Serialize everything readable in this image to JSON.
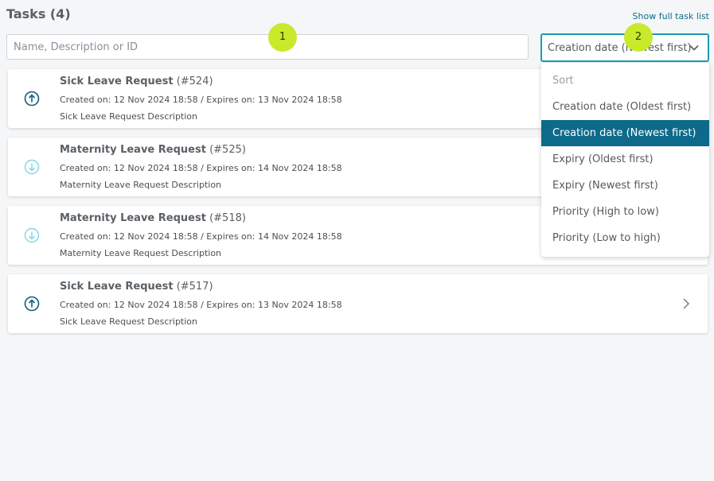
{
  "header": {
    "title": "Tasks (4)",
    "full_list_link": "Show full task list"
  },
  "search": {
    "placeholder": "Name, Description or ID",
    "value": ""
  },
  "sort": {
    "selected": "Creation date (Newest first)",
    "header": "Sort",
    "options": [
      "Creation date (Oldest first)",
      "Creation date (Newest first)",
      "Expiry (Oldest first)",
      "Expiry (Newest first)",
      "Priority (High to low)",
      "Priority (Low to high)"
    ]
  },
  "tasks": [
    {
      "name": "Sick Leave Request",
      "id": "(#524)",
      "dates": "Created on: 12 Nov 2024 18:58 / Expires on: 13 Nov 2024 18:58",
      "description": "Sick Leave Request Description",
      "priority": "high"
    },
    {
      "name": "Maternity Leave Request",
      "id": "(#525)",
      "dates": "Created on: 12 Nov 2024 18:58 / Expires on: 14 Nov 2024 18:58",
      "description": "Maternity Leave Request Description",
      "priority": "low"
    },
    {
      "name": "Maternity Leave Request",
      "id": "(#518)",
      "dates": "Created on: 12 Nov 2024 18:58 / Expires on: 14 Nov 2024 18:58",
      "description": "Maternity Leave Request Description",
      "priority": "low"
    },
    {
      "name": "Sick Leave Request",
      "id": "(#517)",
      "dates": "Created on: 12 Nov 2024 18:58 / Expires on: 13 Nov 2024 18:58",
      "description": "Sick Leave Request Description",
      "priority": "high"
    }
  ],
  "markers": [
    "1",
    "2"
  ],
  "colors": {
    "accent": "#0d6a8a",
    "focus_border": "#1a9bb5",
    "high_priority_icon": "#0e5f7c",
    "low_priority_icon": "#7fd6e6",
    "marker": "#c9e92b"
  }
}
